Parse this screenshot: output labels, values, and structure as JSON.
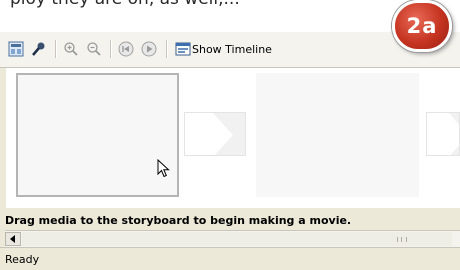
{
  "caption": {
    "cropped_text": "ploy they are on, as well,..."
  },
  "badge": {
    "label": "2a"
  },
  "toolbar": {
    "icons": [
      "storyboard-view-icon",
      "narrate-icon",
      "zoom-in-icon",
      "zoom-out-icon",
      "rewind-icon",
      "play-icon",
      "timeline-icon"
    ],
    "show_timeline_label": "Show Timeline"
  },
  "storyboard": {
    "hint": "Drag media to the storyboard to begin making a movie."
  },
  "status": {
    "text": "Ready"
  },
  "colors": {
    "window_bg": "#ece9d8",
    "badge_red": "#c53421",
    "frame_fill": "#f7f7f7"
  }
}
